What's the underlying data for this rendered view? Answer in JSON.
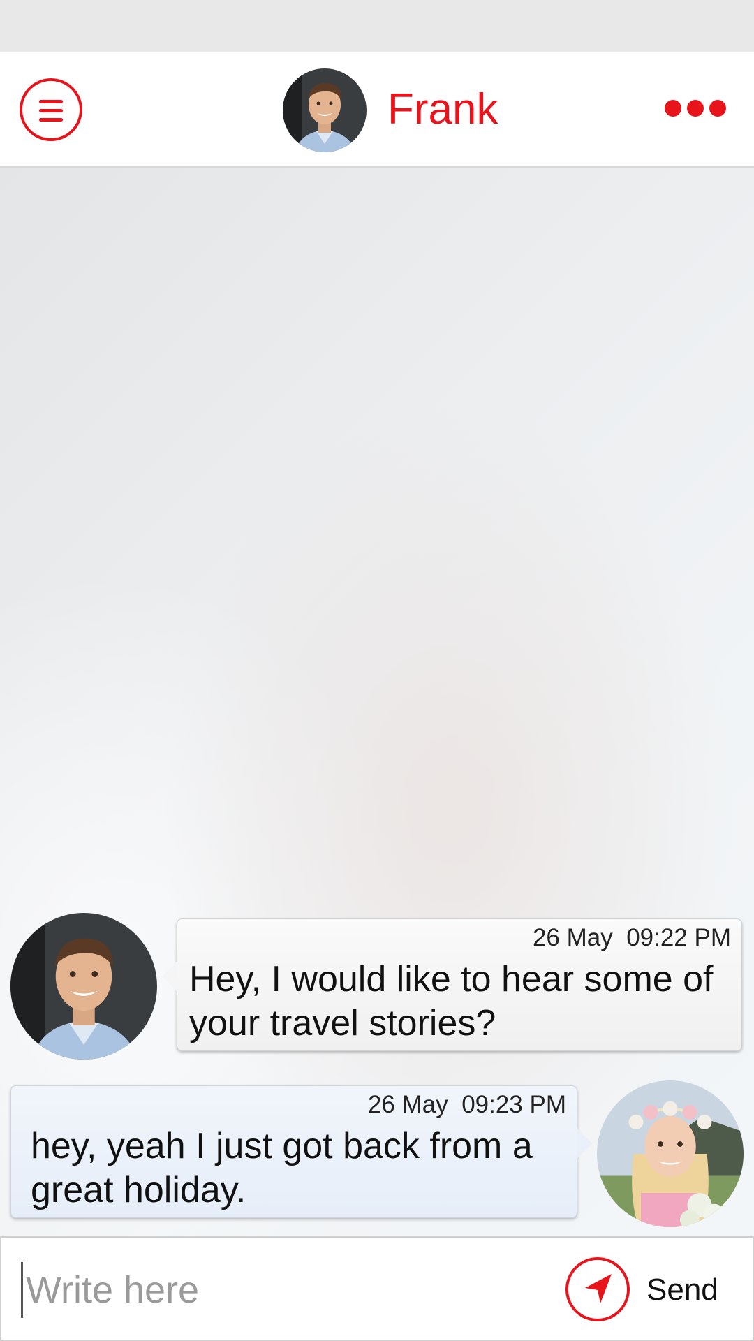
{
  "header": {
    "contact_name": "Frank",
    "accent_color": "#e8141c",
    "menu_icon": "hamburger-menu-icon",
    "more_icon": "more-dots-icon"
  },
  "messages": [
    {
      "sender": "Frank",
      "direction": "incoming",
      "date": "26 May",
      "time": "09:22 PM",
      "text": "Hey, I would like to hear some of your travel stories?"
    },
    {
      "sender": "me",
      "direction": "outgoing",
      "date": "26 May",
      "time": "09:23 PM",
      "text": "hey, yeah I just got back from a great holiday."
    }
  ],
  "composer": {
    "placeholder": "Write here",
    "value": "",
    "send_label": "Send",
    "send_icon": "send-arrow-icon"
  }
}
